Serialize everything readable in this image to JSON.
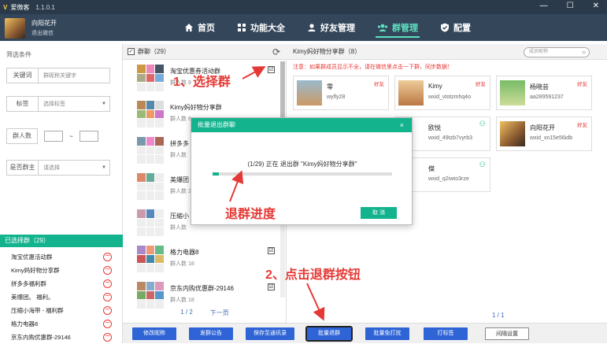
{
  "titlebar": {
    "app_name": "爱微客",
    "version": "1.1.0.1"
  },
  "user": {
    "name": "向阳花开",
    "logout": "退出微信"
  },
  "nav": [
    {
      "label": "首页",
      "icon": "home-icon"
    },
    {
      "label": "功能大全",
      "icon": "grid-icon"
    },
    {
      "label": "好友管理",
      "icon": "user-icon"
    },
    {
      "label": "群管理",
      "icon": "group-icon",
      "active": true
    },
    {
      "label": "配置",
      "icon": "shield-check-icon"
    }
  ],
  "filters": {
    "title": "筛选条件",
    "keyword_label": "关键词",
    "keyword_placeholder": "群昵称关键字",
    "tag_label": "标签",
    "tag_value": "选择标签",
    "count_label": "群人数",
    "count_sep": "~",
    "owner_label": "是否群主",
    "owner_value": "请选择"
  },
  "selected": {
    "header": "已选择群（29）",
    "items": [
      "淘宝优惠活动群",
      "Kimy妈好物分享群",
      "拼多多福利群",
      "美爆团。    福利。",
      "压缩小海带 - 福利群",
      "格力电器8",
      "京东内购优惠群-29146"
    ]
  },
  "groups": {
    "header": "群聊（29）",
    "items": [
      {
        "name": "淘宝优惠券活动群",
        "count": "群人数 8",
        "checked": "☑"
      },
      {
        "name": "Kimy妈好物分享群",
        "count": "群人数 8",
        "checked": ""
      },
      {
        "name": "拼多多",
        "count": "群人数",
        "checked": ""
      },
      {
        "name": "美爆团",
        "count": "群人数 2",
        "checked": ""
      },
      {
        "name": "压缩小",
        "count": "群人数",
        "checked": ""
      },
      {
        "name": "格力电器8",
        "count": "群人数 18",
        "checked": "☑"
      },
      {
        "name": "京东内购优惠群-29146",
        "count": "群人数 18",
        "checked": "☑"
      }
    ],
    "page": "1 / 2",
    "next": "下一页"
  },
  "members": {
    "header": "Kimy妈好物分享群（8）",
    "search_placeholder": "成员昵称",
    "notice": "注意：如果群成员显示不全，请在微信里点击一下群，同步数据！",
    "items": [
      {
        "name": "零",
        "wxid": "wyfly28",
        "tag": "好友"
      },
      {
        "name": "Kimy",
        "wxid": "wxid_vtotzmhq4o",
        "tag": "好友"
      },
      {
        "name": "杨晓芸",
        "wxid": "aa289591237",
        "tag": "好友"
      },
      {
        "name": "欧悦",
        "wxid": "wxid_49tzb7vyrb3",
        "tag": "add-friend-icon"
      },
      {
        "name": "向阳花开",
        "wxid": "wxid_xn15e56idb",
        "tag": "好友"
      },
      {
        "name": "傑",
        "wxid": "wxid_q2iwto3rze",
        "tag": "add-friend-icon"
      }
    ],
    "page": "1 / 1"
  },
  "bottom_buttons": [
    "修改昵称",
    "发群公告",
    "保存至通讯录",
    "批量退群",
    "批量免打扰",
    "打标签",
    "间隔设置"
  ],
  "dialog": {
    "title": "批量退出群聊",
    "close": "×",
    "progress_text": "(1/29) 正在 退出群 \"Kimy妈好物分享群\"",
    "progress": 0.035,
    "cancel": "取 消"
  },
  "annotations": {
    "step1": "1、选择群",
    "progress": "退群进度",
    "step2": "2、点击退群按钮"
  },
  "colors": {
    "accent": "#13b38e",
    "header": "#33465a",
    "button": "#2f64d6",
    "annotation": "#e53935"
  }
}
